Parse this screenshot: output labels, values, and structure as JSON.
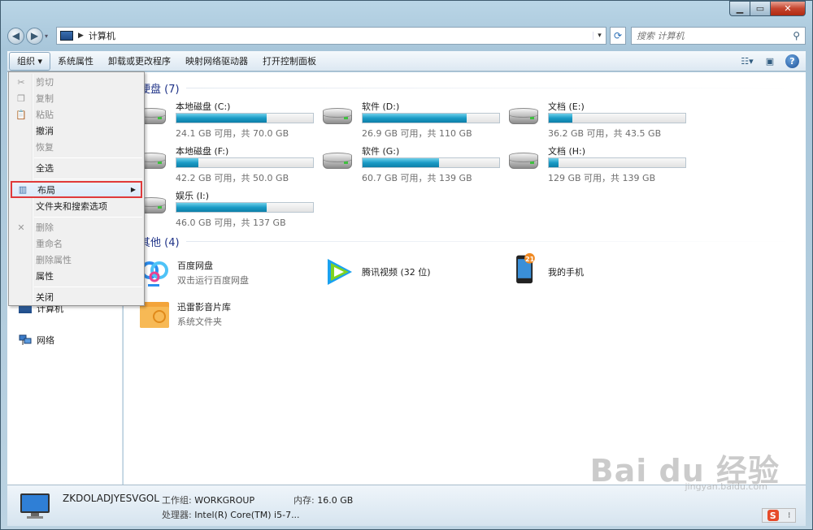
{
  "breadcrumb": {
    "location": "计算机"
  },
  "search": {
    "placeholder": "搜索 计算机"
  },
  "toolbar": {
    "organize": "组织 ▾",
    "system_properties": "系统属性",
    "uninstall": "卸载或更改程序",
    "map_drive": "映射网络驱动器",
    "control_panel": "打开控制面板"
  },
  "menu": {
    "cut": "剪切",
    "copy": "复制",
    "paste": "粘贴",
    "undo": "撤消",
    "redo": "恢复",
    "select_all": "全选",
    "layout": "布局",
    "folder_options": "文件夹和搜索选项",
    "delete": "删除",
    "rename": "重命名",
    "remove_props": "删除属性",
    "properties": "属性",
    "close": "关闭"
  },
  "nav": {
    "computer": "计算机",
    "network": "网络"
  },
  "groups": {
    "hdd": "硬盘 (7)",
    "other": "其他 (4)"
  },
  "drives": [
    {
      "name": "本地磁盘 (C:)",
      "info": "24.1 GB 可用，共 70.0 GB",
      "used": 0.66
    },
    {
      "name": "软件 (D:)",
      "info": "26.9 GB 可用，共 110 GB",
      "used": 0.76
    },
    {
      "name": "文档 (E:)",
      "info": "36.2 GB 可用，共 43.5 GB",
      "used": 0.17
    },
    {
      "name": "本地磁盘 (F:)",
      "info": "42.2 GB 可用，共 50.0 GB",
      "used": 0.16
    },
    {
      "name": "软件 (G:)",
      "info": "60.7 GB 可用，共 139 GB",
      "used": 0.56
    },
    {
      "name": "文档 (H:)",
      "info": "129 GB 可用，共 139 GB",
      "used": 0.07
    },
    {
      "name": "娱乐 (I:)",
      "info": "46.0 GB 可用，共 137 GB",
      "used": 0.66
    }
  ],
  "others": [
    {
      "name": "百度网盘",
      "sub": "双击运行百度网盘"
    },
    {
      "name": "腾讯视频 (32 位)",
      "sub": ""
    },
    {
      "name": "我的手机",
      "sub": ""
    },
    {
      "name": "迅雷影音片库",
      "sub": "系统文件夹"
    }
  ],
  "phone_badge": "21",
  "details": {
    "pc_name": "ZKDOLADJYESVGOL",
    "workgroup_label": "工作组:",
    "workgroup": "WORKGROUP",
    "memory_label": "内存:",
    "memory": "16.0 GB",
    "cpu_label": "处理器:",
    "cpu": "Intel(R) Core(TM) i5-7..."
  },
  "watermark": {
    "main": "Bai du 经验",
    "sub": "jingyan.baidu.com"
  },
  "colors": {
    "accent": "#1e3287",
    "bar_fill": "#1a9bc6",
    "highlight_border": "#e03a3a"
  }
}
